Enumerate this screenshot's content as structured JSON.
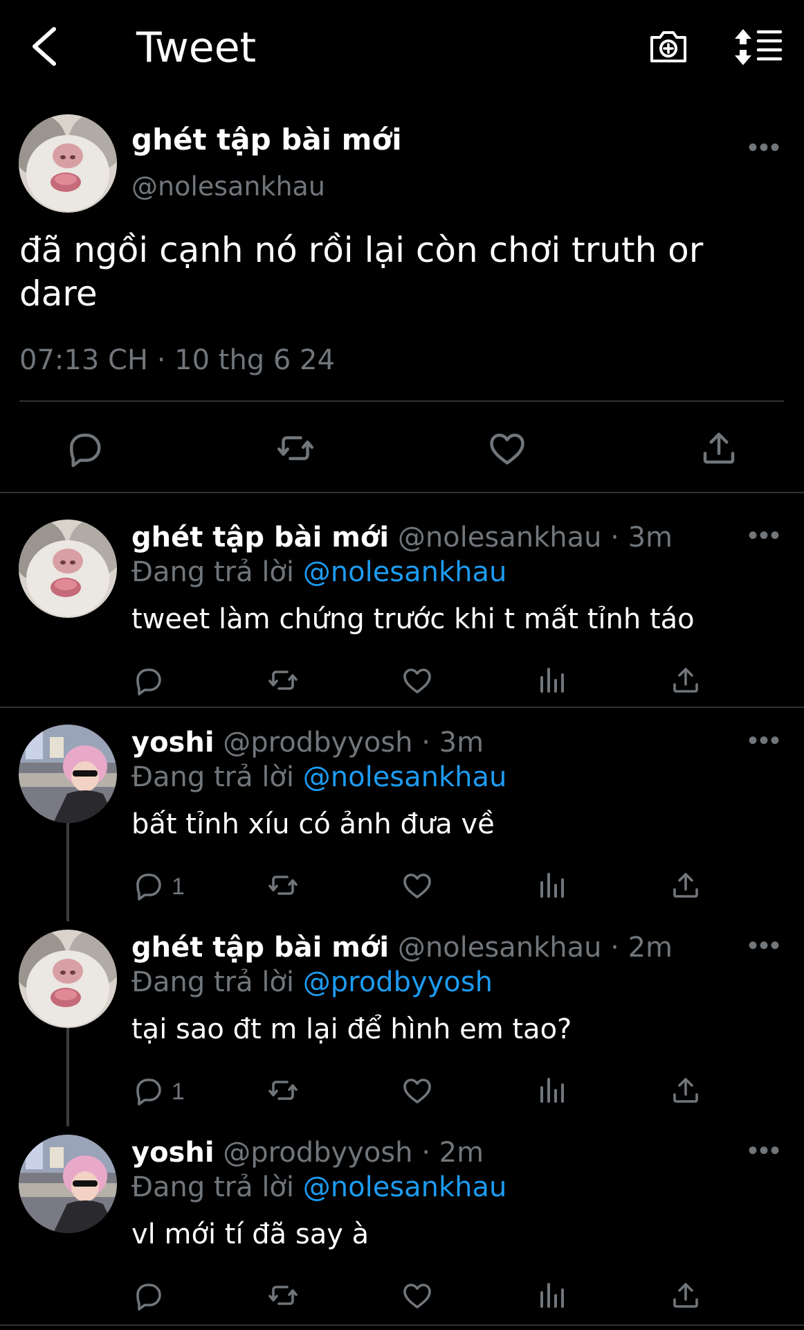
{
  "header": {
    "title": "Tweet",
    "back_icon": "chevron-left-icon",
    "camera_icon": "camera-plus-icon",
    "sort_icon": "sort-icon"
  },
  "main_tweet": {
    "name": "ghét tập bài mới",
    "handle": "@nolesankhau",
    "text": "đã ngồi cạnh nó rồi lại còn chơi truth or dare",
    "timestamp": "07:13 CH · 10 thg 6 24"
  },
  "replies": [
    {
      "name": "ghét tập bài mới",
      "meta": "@nolesankhau · 3m",
      "replying_label": "Đang trả lời",
      "mention": "@nolesankhau",
      "text": "tweet làm chứng trước khi t mất tỉnh táo",
      "reply_count": ""
    },
    {
      "name": "yoshi",
      "meta": "@prodbyyosh · 3m",
      "replying_label": "Đang trả lời",
      "mention": "@nolesankhau",
      "text": "bất tỉnh xíu có ảnh đưa về",
      "reply_count": "1"
    },
    {
      "name": "ghét tập bài mới",
      "meta": "@nolesankhau · 2m",
      "replying_label": "Đang trả lời",
      "mention": "@prodbyyosh",
      "text": "tại sao đt m lại để hình em tao?",
      "reply_count": "1"
    },
    {
      "name": "yoshi",
      "meta": "@prodbyyosh · 2m",
      "replying_label": "Đang trả lời",
      "mention": "@nolesankhau",
      "text": "vl mới tí đã say à",
      "reply_count": ""
    }
  ],
  "colors": {
    "background": "#000000",
    "text": "#ffffff",
    "secondary": "#71767b",
    "link": "#1d9bf0",
    "divider": "#2f3336"
  }
}
